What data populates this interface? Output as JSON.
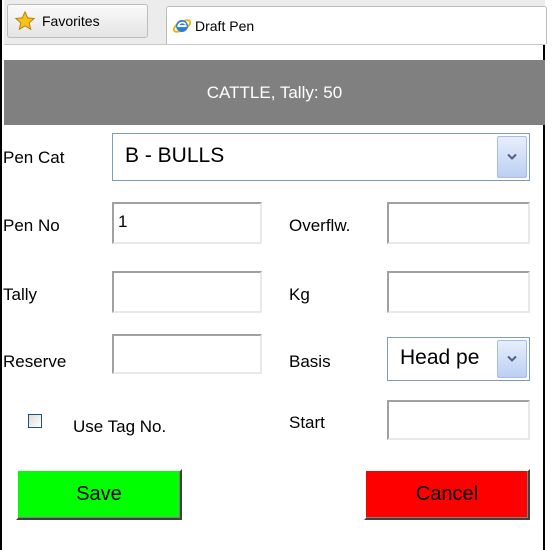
{
  "browser": {
    "favorites_label": "Favorites",
    "tab_title": "Draft Pen"
  },
  "header": {
    "title": "CATTLE, Tally: 50"
  },
  "form": {
    "pen_cat": {
      "label": "Pen Cat",
      "value": "B - BULLS"
    },
    "pen_no": {
      "label": "Pen No",
      "value": "1"
    },
    "overflow": {
      "label": "Overflw.",
      "value": ""
    },
    "tally": {
      "label": "Tally",
      "value": ""
    },
    "kg": {
      "label": "Kg",
      "value": ""
    },
    "reserve": {
      "label": "Reserve",
      "value": ""
    },
    "basis": {
      "label": "Basis",
      "value": "Head pe"
    },
    "use_tag": {
      "label": "Use Tag No.",
      "checked": false
    },
    "start": {
      "label": "Start",
      "value": ""
    }
  },
  "actions": {
    "save_label": "Save",
    "cancel_label": "Cancel",
    "save_color": "#00ff00",
    "cancel_color": "#ff0000"
  }
}
